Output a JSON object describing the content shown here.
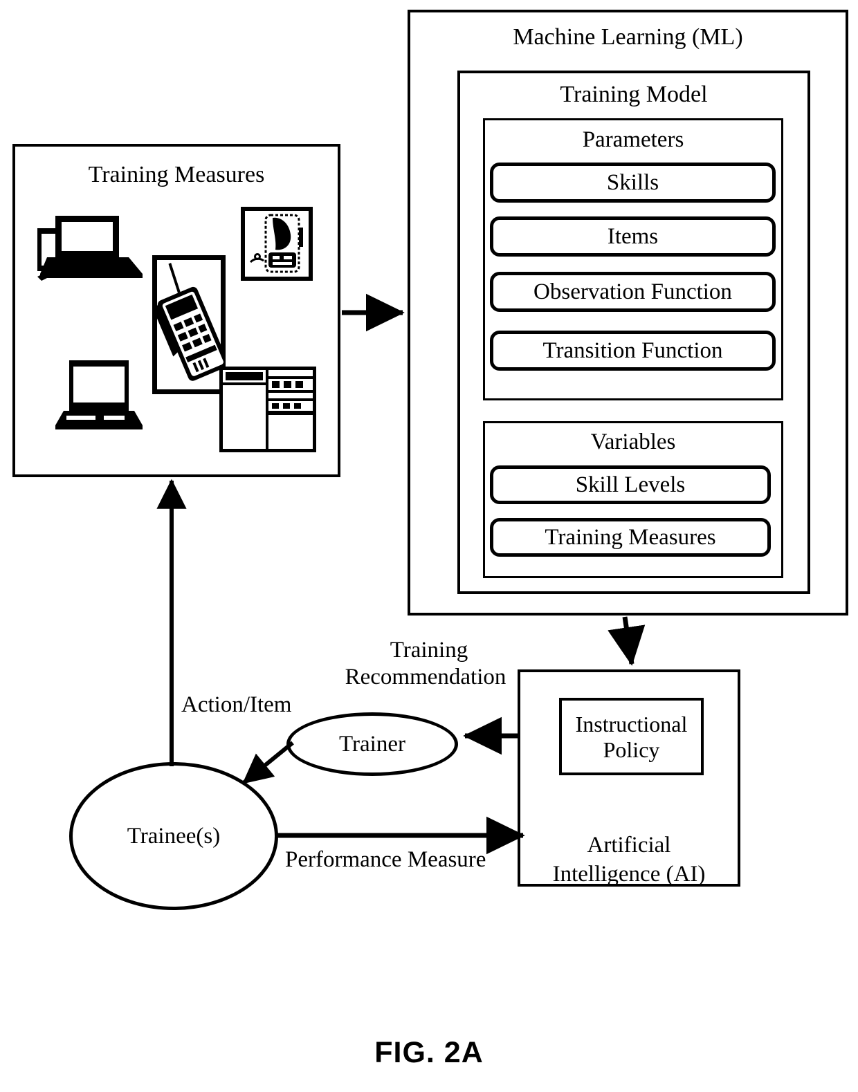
{
  "figure": {
    "caption": "FIG. 2A",
    "colors": {
      "stroke": "#000000",
      "background": "#ffffff"
    }
  },
  "training_measures_box": {
    "title": "Training Measures",
    "devices": [
      {
        "name": "desktop-computer-icon"
      },
      {
        "name": "laptop-computer-icon"
      },
      {
        "name": "handheld-radio-icon"
      },
      {
        "name": "pda-device-icon"
      },
      {
        "name": "control-panel-icon"
      }
    ]
  },
  "ml_box": {
    "title": "Machine Learning (ML)",
    "training_model": {
      "title": "Training Model",
      "parameters": {
        "title": "Parameters",
        "items": [
          "Skills",
          "Items",
          "Observation Function",
          "Transition Function"
        ]
      },
      "variables": {
        "title": "Variables",
        "items": [
          "Skill Levels",
          "Training Measures"
        ]
      }
    }
  },
  "ai_box": {
    "inner_title": "Instructional\nPolicy",
    "title_line1": "Artificial",
    "title_line2": "Intelligence (AI)"
  },
  "nodes": {
    "trainer": "Trainer",
    "trainee": "Trainee(s)"
  },
  "edges": {
    "action_item": "Action/Item",
    "training_recommendation_line1": "Training",
    "training_recommendation_line2": "Recommendation",
    "performance_measure": "Performance Measure"
  }
}
